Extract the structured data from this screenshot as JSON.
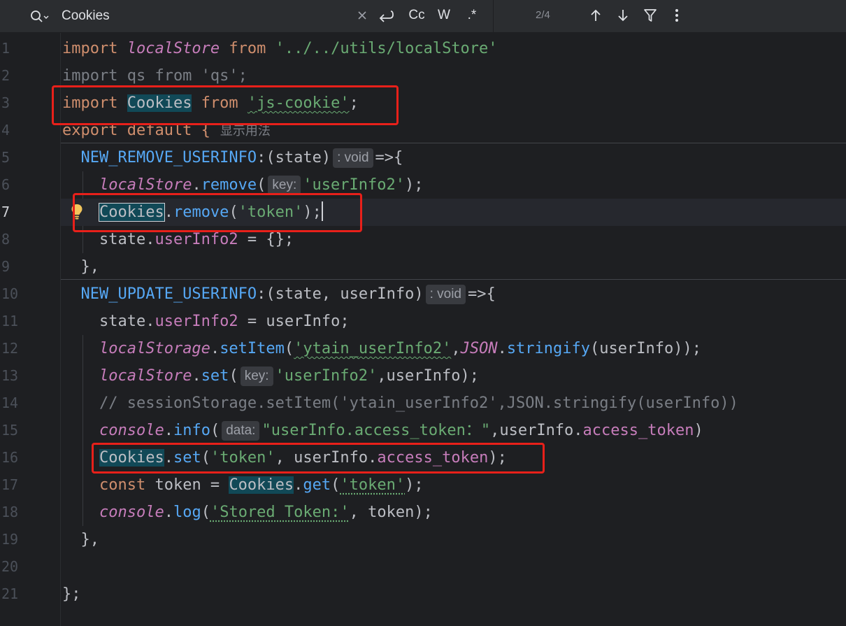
{
  "find_bar": {
    "query": "Cookies",
    "match_count": "2/4",
    "case_label": "Cc",
    "word_label": "W",
    "regex_label": ".*"
  },
  "editor": {
    "line_numbers": [
      "1",
      "2",
      "3",
      "4",
      "5",
      "6",
      "7",
      "8",
      "9",
      "10",
      "11",
      "12",
      "13",
      "14",
      "15",
      "16",
      "17",
      "18",
      "19",
      "20",
      "21"
    ],
    "active_line": "7",
    "inlay_usage_hint": "显示用法",
    "param_hints": {
      "key": "key:",
      "data": "data:",
      "void": ": void"
    },
    "lines": {
      "l1": [
        "import ",
        "localStore",
        " from ",
        "'../../utils/localStore'"
      ],
      "l2": "import qs from 'qs';",
      "l3": [
        "import ",
        "Cookies",
        " from ",
        "'js-cookie'",
        ";"
      ],
      "l4": [
        "export default {"
      ],
      "l5": [
        "  NEW_REMOVE_USERINFO",
        ":(state)",
        "=>{"
      ],
      "l6": [
        "    ",
        "localStore",
        ".",
        "remove",
        "(",
        "'userInfo2'",
        ");"
      ],
      "l7": [
        "    ",
        "Cookies",
        ".",
        "remove",
        "(",
        "'token'",
        ");"
      ],
      "l8": [
        "    state.",
        "userInfo2",
        " = {};"
      ],
      "l9": "  },",
      "l10": [
        "  NEW_UPDATE_USERINFO",
        ":(state, userInfo)",
        "=>{"
      ],
      "l11": [
        "    state.",
        "userInfo2",
        " = userInfo;"
      ],
      "l12": [
        "    ",
        "localStorage",
        ".",
        "setItem",
        "(",
        "'ytain_userInfo2'",
        ",",
        "JSON",
        ".",
        "stringify",
        "(userInfo));"
      ],
      "l13": [
        "    ",
        "localStore",
        ".",
        "set",
        "(",
        "'userInfo2'",
        ",userInfo);"
      ],
      "l14": "    // sessionStorage.setItem('ytain_userInfo2',JSON.stringify(userInfo))",
      "l15": [
        "    ",
        "console",
        ".",
        "info",
        "(",
        "\"userInfo.access_token：\"",
        ",userInfo.",
        "access_token",
        ")"
      ],
      "l16": [
        "    ",
        "Cookies",
        ".",
        "set",
        "(",
        "'token'",
        ", userInfo.",
        "access_token",
        ");"
      ],
      "l17": [
        "    ",
        "const",
        " token = ",
        "Cookies",
        ".",
        "get",
        "(",
        "'token'",
        ");"
      ],
      "l18": [
        "    ",
        "console",
        ".",
        "log",
        "(",
        "'Stored Token:'",
        ", token);"
      ],
      "l19": "  },",
      "l20": "",
      "l21": "};"
    }
  },
  "colors": {
    "keyword": "#cf8e6d",
    "string": "#6aab73",
    "property": "#c77dbb",
    "function": "#56a8f5",
    "comment": "#7a7e85",
    "match_highlight": "#114957",
    "annotation_box": "#e8201a"
  },
  "icons": [
    "search-icon",
    "clear-icon",
    "replace-icon",
    "match-case-toggle",
    "whole-word-toggle",
    "regex-toggle",
    "previous-match-icon",
    "next-match-icon",
    "filter-icon",
    "more-options-icon",
    "lightbulb-icon"
  ]
}
